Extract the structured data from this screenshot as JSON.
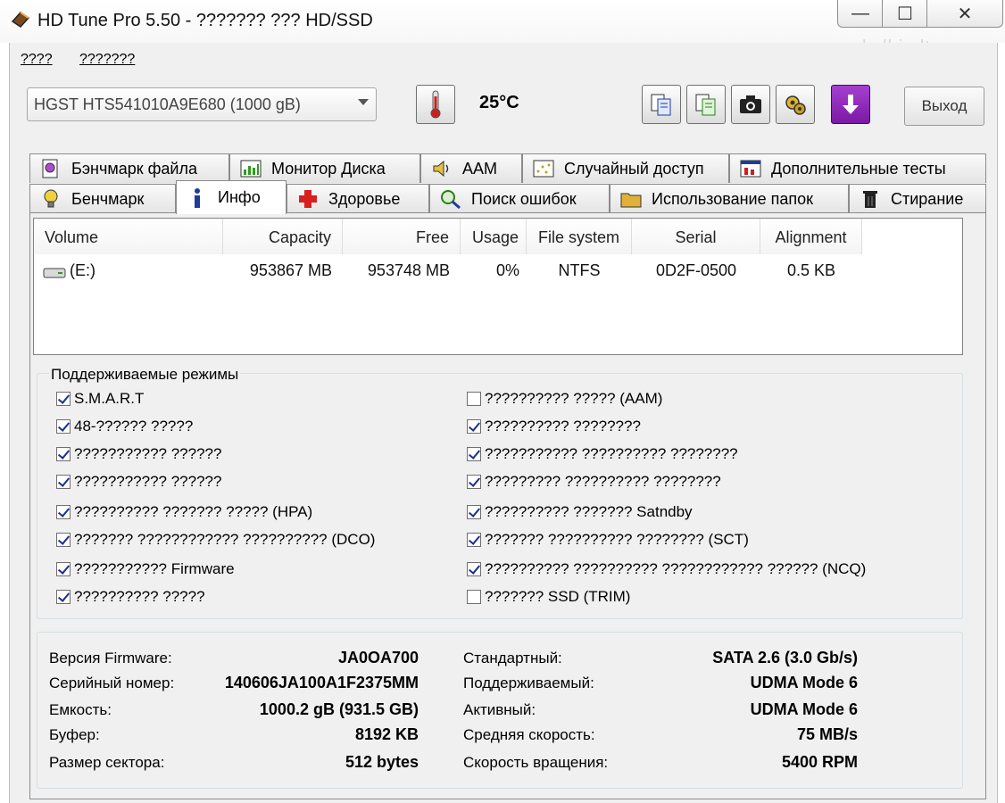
{
  "window": {
    "title": "HD Tune Pro 5.50 - ??????? ??? HD/SSD",
    "watermark": "skelbiu.lt",
    "minimize_glyph": "—",
    "maximize_glyph": "☐",
    "close_glyph": "✕"
  },
  "menu": {
    "items": [
      "????",
      "???????"
    ]
  },
  "toolbar": {
    "drive": "HGST HTS541010A9E680 (1000 gB)",
    "temperature": "25°C",
    "exit_label": "Выход"
  },
  "tabs": {
    "row1": [
      "Бэнчмарк файла",
      "Монитор Диска",
      "AAM",
      "Случайный доступ",
      "Дополнительные тесты"
    ],
    "row2": [
      "Бенчмарк",
      "Инфо",
      "Здоровье",
      "Поиск ошибок",
      "Использование папок",
      "Стирание"
    ],
    "active": "Инфо"
  },
  "volumes": {
    "columns": [
      "Volume",
      "Capacity",
      "Free",
      "Usage",
      "File system",
      "Serial",
      "Alignment"
    ],
    "rows": [
      {
        "volume": "(E:)",
        "capacity": "953867 MB",
        "free": "953748 MB",
        "usage": "0%",
        "file_system": "NTFS",
        "serial": "0D2F-0500",
        "alignment": "0.5 KB"
      }
    ]
  },
  "modes": {
    "title": "Поддерживаемые режимы",
    "left": [
      {
        "label": "S.M.A.R.T",
        "checked": true
      },
      {
        "label": "48-?????? ?????",
        "checked": true
      },
      {
        "label": "??????????? ??????",
        "checked": true
      },
      {
        "label": "??????????? ??????",
        "checked": true
      },
      {
        "label": "?????????? ??????? ????? (HPA)",
        "checked": true
      },
      {
        "label": "??????? ???????????? ?????????? (DCO)",
        "checked": true
      },
      {
        "label": "??????????? Firmware",
        "checked": true
      },
      {
        "label": "?????????? ?????",
        "checked": true
      }
    ],
    "right": [
      {
        "label": "?????????? ????? (AAM)",
        "checked": false
      },
      {
        "label": "?????????? ????????",
        "checked": true
      },
      {
        "label": "??????????? ?????????? ????????",
        "checked": true
      },
      {
        "label": "????????? ?????????? ????????",
        "checked": true
      },
      {
        "label": "?????????? ??????? Satndby",
        "checked": true
      },
      {
        "label": "??????? ?????????? ???????? (SCT)",
        "checked": true
      },
      {
        "label": "?????????? ?????????? ???????????? ??????  (NCQ)",
        "checked": true
      },
      {
        "label": "??????? SSD (TRIM)",
        "checked": false
      }
    ]
  },
  "info": {
    "left": [
      {
        "label": "Версия Firmware:",
        "value": "JA0OA700"
      },
      {
        "label": "Серийный номер:",
        "value": "140606JA100A1F2375MM"
      },
      {
        "label": "Емкость:",
        "value": "1000.2 gB (931.5 GB)"
      },
      {
        "label": "Буфер:",
        "value": "8192 KB"
      },
      {
        "label": "Размер сектора:",
        "value": "512 bytes"
      }
    ],
    "right": [
      {
        "label": "Стандартный:",
        "value": "SATA 2.6 (3.0 Gb/s)"
      },
      {
        "label": "Поддерживаемый:",
        "value": "UDMA Mode 6"
      },
      {
        "label": "Активный:",
        "value": "UDMA Mode 6"
      },
      {
        "label": "Средняя скорость:",
        "value": "75 MB/s"
      },
      {
        "label": "Скорость вращения:",
        "value": "5400 RPM"
      }
    ]
  },
  "colors": {
    "accent_download": "#8a1fb0",
    "thermo": "#c8201e",
    "checkmark": "#1d2e8c"
  },
  "icons": [
    "app-icon",
    "thermometer-icon",
    "copy-text-icon",
    "copy-info-icon",
    "camera-icon",
    "options-icon",
    "download-icon"
  ]
}
